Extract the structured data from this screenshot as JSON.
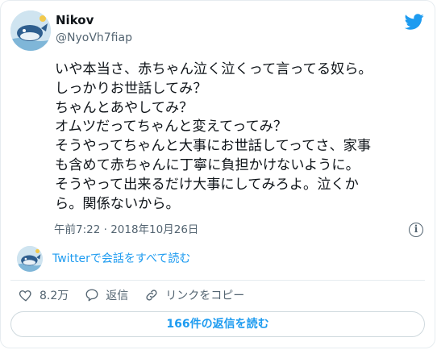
{
  "author": {
    "name": "Nikov",
    "handle": "@NyoVh7fiap"
  },
  "tweet": {
    "text": "いや本当さ、赤ちゃん泣く泣くって言ってる奴ら。\nしっかりお世話してみ？\nちゃんとあやしてみ？\nオムツだってちゃんと変えてってみ？\nそうやってちゃんと大事にお世話してってさ、家事\nも含めて赤ちゃんに丁寧に負担かけないように。\nそうやって出来るだけ大事にしてみろよ。泣くか\nら。関係ないから。",
    "timestamp": "午前7:22 · 2018年10月26日"
  },
  "conversation_link": "Twitterで会話をすべて読む",
  "actions": {
    "likes": "8.2万",
    "reply_label": "返信",
    "copy_link_label": "リンクをコピー"
  },
  "read_replies_button": "166件の返信を読む",
  "colors": {
    "accent": "#1d9bf0",
    "like": "#536471",
    "text": "#0f1419",
    "secondary": "#536471"
  },
  "icons": [
    "twitter-bird-icon",
    "info-icon",
    "heart-icon",
    "reply-icon",
    "link-icon"
  ]
}
